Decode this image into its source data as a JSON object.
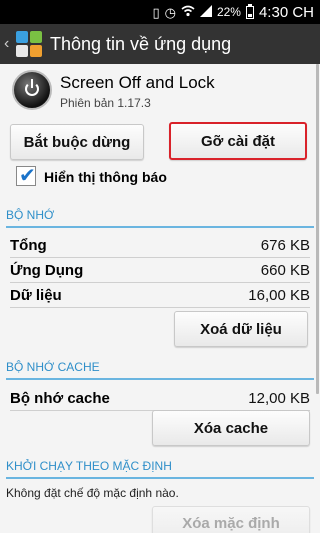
{
  "status_bar": {
    "battery_percent_text": "22%",
    "battery_level": 0.22,
    "time": "4:30 CH",
    "icons": [
      "phone-vibrate-icon",
      "alarm-icon",
      "wifi-icon",
      "signal-icon",
      "battery-icon"
    ]
  },
  "action_bar": {
    "title": "Thông tin về ứng dụng",
    "background": "#333333"
  },
  "app": {
    "name": "Screen Off and Lock",
    "version": "Phiên bản 1.17.3"
  },
  "buttons": {
    "force_stop": "Bắt buộc dừng",
    "uninstall": "Gỡ cài đặt",
    "clear_data": "Xoá dữ liệu",
    "clear_cache": "Xóa cache",
    "clear_defaults": "Xóa mặc định"
  },
  "notifications": {
    "label": "Hiển thị thông báo",
    "checked": true
  },
  "storage": {
    "header": "BỘ NHỚ",
    "rows": [
      {
        "label": "Tổng",
        "value": "676 KB"
      },
      {
        "label": "Ứng Dụng",
        "value": "660 KB"
      },
      {
        "label": "Dữ liệu",
        "value": "16,00 KB"
      }
    ]
  },
  "cache": {
    "header": "BỘ NHỚ CACHE",
    "label": "Bộ nhớ cache",
    "value": "12,00 KB"
  },
  "launch": {
    "header": "KHỞI CHẠY THEO MẶC ĐỊNH",
    "text": "Không đặt chế độ mặc định nào."
  },
  "colors": {
    "accent": "#2f8fc9",
    "highlight_border": "#d9222a",
    "checkbox": "#1a73c9"
  }
}
